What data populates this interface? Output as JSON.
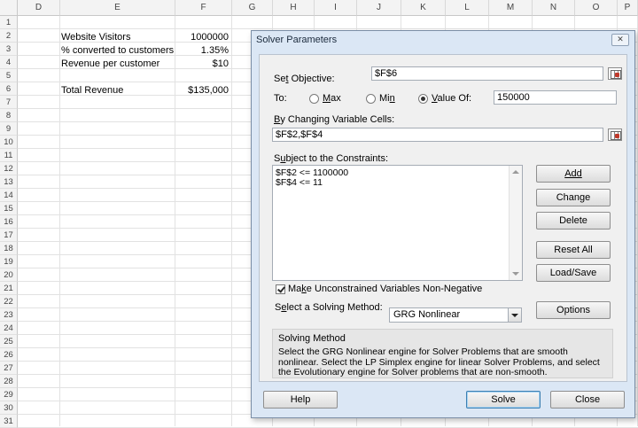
{
  "columns": [
    "D",
    "E",
    "F",
    "G",
    "H",
    "I",
    "J",
    "K",
    "L",
    "M",
    "N",
    "O",
    "P"
  ],
  "rows": [
    "1",
    "2",
    "3",
    "4",
    "5",
    "6",
    "7",
    "8",
    "9",
    "10",
    "11",
    "12",
    "13",
    "14",
    "15",
    "16",
    "17",
    "18",
    "19",
    "20",
    "21",
    "22",
    "23",
    "24",
    "25",
    "26",
    "27",
    "28",
    "29",
    "30",
    "31"
  ],
  "cells": {
    "e2": "Website Visitors",
    "f2": "1000000",
    "e3": "% converted to customers",
    "f3": "1.35%",
    "e4": "Revenue per customer",
    "f4": "$10",
    "e6": "Total Revenue",
    "f6": "$135,000"
  },
  "dialog": {
    "title": "Solver Parameters",
    "close_label": "✕",
    "objective_label_pre": "Se",
    "objective_label_u": "t",
    "objective_label_post": " Objective:",
    "objective_value": "$F$6",
    "to_label": "To:",
    "max_label_u": "M",
    "max_label_post": "ax",
    "min_label_pre": "Mi",
    "min_label_u": "n",
    "valueof_label_u": "V",
    "valueof_label_post": "alue Of:",
    "valueof_value": "150000",
    "changing_label_u": "B",
    "changing_label_post": "y Changing Variable Cells:",
    "changing_value": "$F$2,$F$4",
    "constraints_label_pre": "S",
    "constraints_label_u": "u",
    "constraints_label_post": "bject to the Constraints:",
    "constraints": [
      "$F$2 <= 1100000",
      "$F$4 <= 11"
    ],
    "buttons": {
      "add": "Add",
      "change": "Change",
      "delete": "Delete",
      "reset_all": "Reset All",
      "load_save": "Load/Save",
      "options": "Options",
      "help": "Help",
      "solve": "Solve",
      "close": "Close"
    },
    "nonneg_label_pre": "Ma",
    "nonneg_label_u": "k",
    "nonneg_label_post": "e Unconstrained Variables Non-Negative",
    "nonneg_checked": true,
    "method_label_pre": "S",
    "method_label_u": "e",
    "method_label_post": "lect a Solving Method:",
    "method_value": "GRG Nonlinear",
    "method_section_title": "Solving Method",
    "method_description": "Select the GRG Nonlinear engine for Solver Problems that are smooth nonlinear. Select the LP Simplex engine for linear Solver Problems, and select the Evolutionary engine for Solver problems that are non-smooth."
  }
}
